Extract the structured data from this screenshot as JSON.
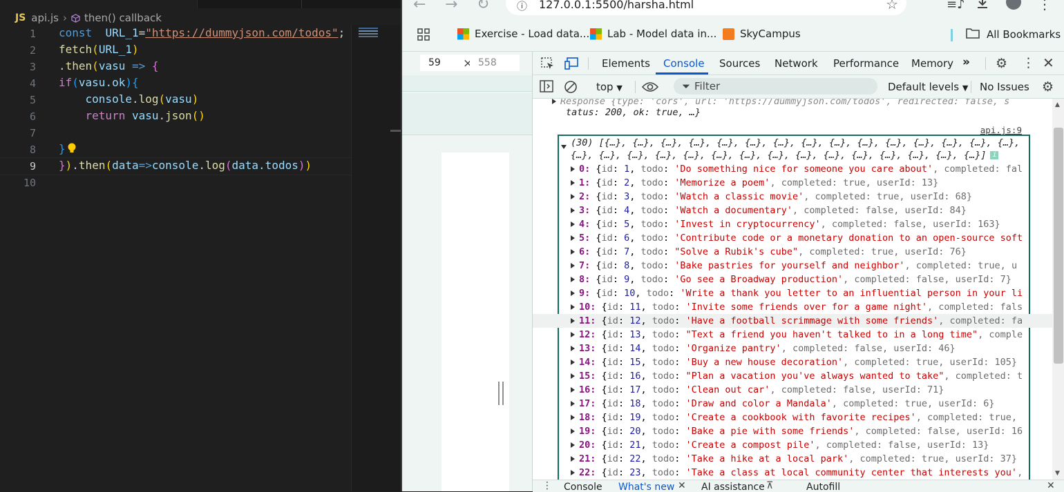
{
  "editor": {
    "breadcrumb": {
      "lang_badge": "JS",
      "file": "api.js",
      "symbol": "then() callback"
    },
    "line_numbers": [
      "1",
      "2",
      "3",
      "4",
      "5",
      "6",
      "7",
      "8",
      "9",
      "10"
    ],
    "active_line": "9",
    "code": {
      "l1": {
        "kw": "const",
        "name": "URL_1",
        "eq": "=",
        "str": "\"https://dummyjson.com/todos\"",
        "semi": ";"
      },
      "l2": {
        "fn": "fetch",
        "open": "(",
        "arg": "URL_1",
        "close": ")"
      },
      "l3": {
        "dot": ".",
        "fn": "then",
        "open": "(",
        "param": "vasu",
        "arrow": " => ",
        "brace": "{"
      },
      "l4": {
        "kw": "if",
        "open": "(",
        "obj": "vasu",
        "prop": ".ok",
        "close": ")",
        "brace": "{"
      },
      "l5": {
        "obj": "console",
        "dot": ".",
        "fn": "log",
        "open": "(",
        "arg": "vasu",
        "close": ")"
      },
      "l6": {
        "kw": "return",
        "obj": "vasu",
        "dot": ".",
        "fn": "json",
        "parens": "()"
      },
      "l8": {
        "brace": "}"
      },
      "l9": {
        "brace": "}",
        "close": ")",
        "dot": ".",
        "fn": "then",
        "open": "(",
        "param": "data",
        "arrow": "=>",
        "obj": "console",
        "dot2": ".",
        "fn2": "log",
        "open2": "(",
        "arg": "data",
        "prop": ".todos",
        "close2": ")",
        "close3": ")"
      }
    }
  },
  "browser": {
    "url": "127.0.0.1:5500/harsha.html",
    "bookmarks": [
      {
        "label": "Exercise - Load data..."
      },
      {
        "label": "Lab - Model data in..."
      },
      {
        "label": "SkyCampus"
      },
      {
        "label": "All Bookmarks"
      }
    ],
    "viewport": {
      "width": "59",
      "height": "558"
    }
  },
  "devtools": {
    "tabs": [
      "Elements",
      "Console",
      "Sources",
      "Network",
      "Performance",
      "Memory"
    ],
    "active_tab": "Console",
    "context": "top",
    "filter_placeholder": "Filter",
    "levels": "Default levels",
    "issues": "No Issues",
    "source_link": "api.js:9",
    "response_line1": "Response {type: 'cors', url: 'https://dummyjson.com/todos', redirected: false, s",
    "response_line2": "tatus: 200, ok: true, …}",
    "array_header1": "(30) [{…}, {…}, {…}, {…}, {…}, {…}, {…}, {…}, {…}, {…}, {…}, {…}, {…}, {…}, {…},",
    "array_header2": "{…}, {…}, {…}, {…}, {…}, {…}, {…}, {…}, {…}, {…}, {…}, {…}, {…}, {…}, {…}]",
    "items": [
      {
        "idx": "0",
        "id": "1",
        "todo": "'Do something nice for someone you care about'",
        "rest": ", completed: fal"
      },
      {
        "idx": "1",
        "id": "2",
        "todo": "'Memorize a poem'",
        "rest": ", completed: true, userId: 13}"
      },
      {
        "idx": "2",
        "id": "3",
        "todo": "'Watch a classic movie'",
        "rest": ", completed: true, userId: 68}"
      },
      {
        "idx": "3",
        "id": "4",
        "todo": "'Watch a documentary'",
        "rest": ", completed: false, userId: 84}"
      },
      {
        "idx": "4",
        "id": "5",
        "todo": "'Invest in cryptocurrency'",
        "rest": ", completed: false, userId: 163}"
      },
      {
        "idx": "5",
        "id": "6",
        "todo": "'Contribute code or a monetary donation to an open-source soft",
        "rest": ""
      },
      {
        "idx": "6",
        "id": "7",
        "todo": "\"Solve a Rubik's cube\"",
        "rest": ", completed: true, userId: 76}"
      },
      {
        "idx": "7",
        "id": "8",
        "todo": "'Bake pastries for yourself and neighbor'",
        "rest": ", completed: true, u"
      },
      {
        "idx": "8",
        "id": "9",
        "todo": "'Go see a Broadway production'",
        "rest": ", completed: false, userId: 7}"
      },
      {
        "idx": "9",
        "id": "10",
        "todo": "'Write a thank you letter to an influential person in your li",
        "rest": ""
      },
      {
        "idx": "10",
        "id": "11",
        "todo": "'Invite some friends over for a game night'",
        "rest": ", completed: fals"
      },
      {
        "idx": "11",
        "id": "12",
        "todo": "'Have a football scrimmage with some friends'",
        "rest": ", completed: fa"
      },
      {
        "idx": "12",
        "id": "13",
        "todo": "\"Text a friend you haven't talked to in a long time\"",
        "rest": ", comple"
      },
      {
        "idx": "13",
        "id": "14",
        "todo": "'Organize pantry'",
        "rest": ", completed: false, userId: 46}"
      },
      {
        "idx": "14",
        "id": "15",
        "todo": "'Buy a new house decoration'",
        "rest": ", completed: true, userId: 105}"
      },
      {
        "idx": "15",
        "id": "16",
        "todo": "\"Plan a vacation you've always wanted to take\"",
        "rest": ", completed: t"
      },
      {
        "idx": "16",
        "id": "17",
        "todo": "'Clean out car'",
        "rest": ", completed: false, userId: 71}"
      },
      {
        "idx": "17",
        "id": "18",
        "todo": "'Draw and color a Mandala'",
        "rest": ", completed: true, userId: 6}"
      },
      {
        "idx": "18",
        "id": "19",
        "todo": "'Create a cookbook with favorite recipes'",
        "rest": ", completed: true,"
      },
      {
        "idx": "19",
        "id": "20",
        "todo": "'Bake a pie with some friends'",
        "rest": ", completed: false, userId: 16"
      },
      {
        "idx": "20",
        "id": "21",
        "todo": "'Create a compost pile'",
        "rest": ", completed: false, userId: 13}"
      },
      {
        "idx": "21",
        "id": "22",
        "todo": "'Take a hike at a local park'",
        "rest": ", completed: true, userId: 37}"
      },
      {
        "idx": "22",
        "id": "23",
        "todo": "'Take a class at local community center that interests you'",
        "rest": ","
      }
    ],
    "drawer_tabs": [
      "Console",
      "What's new",
      "AI assistance",
      "Autofill"
    ]
  }
}
